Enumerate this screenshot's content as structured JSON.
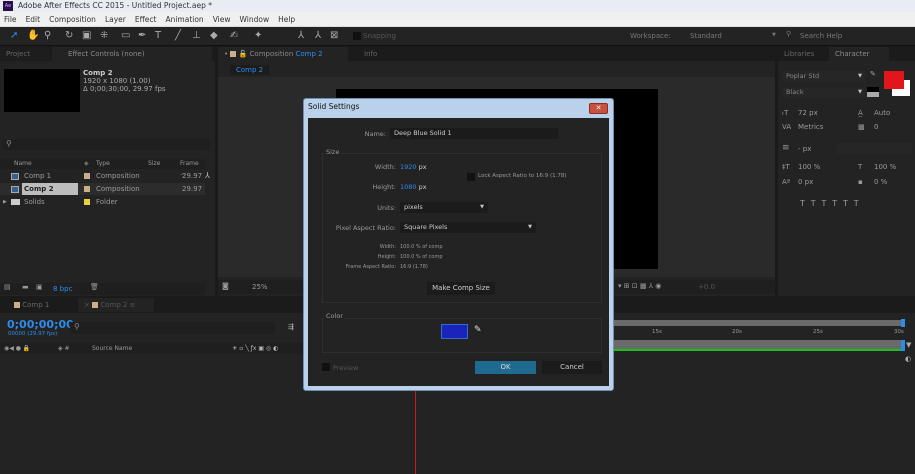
{
  "window": {
    "title": "Adobe After Effects CC 2015 - Untitled Project.aep *",
    "logo": "Ae"
  },
  "menu": [
    "File",
    "Edit",
    "Composition",
    "Layer",
    "Effect",
    "Animation",
    "View",
    "Window",
    "Help"
  ],
  "toolbar": {
    "snapping": "Snapping",
    "workspace_label": "Workspace:",
    "workspace_value": "Standard",
    "search_placeholder": "Search Help"
  },
  "project": {
    "tabs": [
      "Project",
      "Effect Controls (none)"
    ],
    "selected": {
      "name": "Comp 2",
      "dims": "1920 x 1080 (1.00)",
      "duration": "Δ 0;00;30;00, 29.97 fps"
    },
    "columns": [
      "Name",
      "Type",
      "Size",
      "Frame ..."
    ],
    "items": [
      {
        "name": "Comp 1",
        "type": "Composition",
        "frame": "29.97",
        "color": "#c7b08a"
      },
      {
        "name": "Comp 2",
        "type": "Composition",
        "frame": "29.97",
        "color": "#c7b08a"
      },
      {
        "name": "Solids",
        "type": "Folder",
        "frame": "",
        "color": "#e6d23a"
      }
    ],
    "bpc": "8 bpc"
  },
  "composition": {
    "tabs": [
      "Composition Comp 2",
      "Info"
    ],
    "comp_label": "Composition",
    "comp_name": "Comp 2",
    "breadcrumb": "Comp 2",
    "zoom": "25%",
    "exposure": "+0.0"
  },
  "character": {
    "tabs": [
      "Libraries",
      "Character"
    ],
    "font": "Poplar Std",
    "style": "Black",
    "size": "72 px",
    "leading": "Auto",
    "kerning": "Metrics",
    "tracking": "0",
    "stroke": "- px",
    "vscale": "100 %",
    "hscale": "100 %",
    "baseline": "0 px",
    "tsume": "0 %",
    "fill_color": "#e0161a"
  },
  "timeline": {
    "tabs": [
      "Comp 1",
      "Comp 2"
    ],
    "timecode": "0;00;00;00",
    "frame_info": "00000 (29.97 fps)",
    "source_name": "Source Name",
    "ruler": [
      "15s",
      "20s",
      "25s",
      "30s"
    ]
  },
  "dialog": {
    "title": "Solid Settings",
    "name_label": "Name:",
    "name_value": "Deep Blue Solid 1",
    "size_legend": "Size",
    "width_label": "Width:",
    "width_value": "1920",
    "height_label": "Height:",
    "height_value": "1080",
    "unit_px": "px",
    "lock_label": "Lock Aspect Ratio to 16:9 (1.78)",
    "lock_checked": false,
    "units_label": "Units:",
    "units_value": "pixels",
    "par_label": "Pixel Aspect Ratio:",
    "par_value": "Square Pixels",
    "info_width_label": "Width:",
    "info_width": "100.0 % of comp",
    "info_height_label": "Height:",
    "info_height": "100.0 % of comp",
    "info_far_label": "Frame Aspect Ratio:",
    "info_far": "16:9 (1.78)",
    "make_comp_size": "Make Comp Size",
    "color_legend": "Color",
    "color_value": "#1a24b8",
    "preview_label": "Preview",
    "preview_checked": false,
    "ok": "OK",
    "cancel": "Cancel"
  }
}
